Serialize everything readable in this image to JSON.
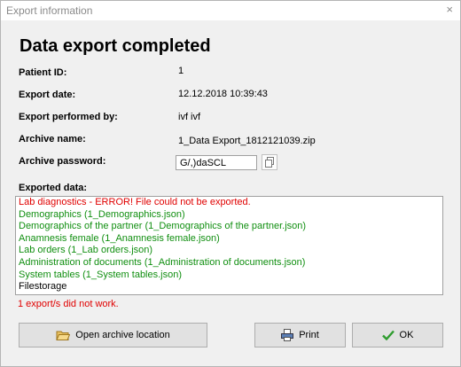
{
  "window": {
    "title": "Export information",
    "close_glyph": "×"
  },
  "heading": "Data export completed",
  "fields": {
    "patient_id_label": "Patient ID:",
    "patient_id_value": "1",
    "export_date_label": "Export date:",
    "export_date_value": "12.12.2018 10:39:43",
    "performed_by_label": "Export performed by:",
    "performed_by_value": "ivf ivf",
    "archive_name_label": "Archive name:",
    "archive_name_value": "1_Data Export_1812121039.zip",
    "archive_password_label": "Archive password:",
    "archive_password_value": "G/,)daSCL"
  },
  "exported": {
    "label": "Exported data:",
    "lines": [
      {
        "text": "Lab diagnostics - ERROR! File could not be exported.",
        "status": "error"
      },
      {
        "text": "Demographics (1_Demographics.json)",
        "status": "ok"
      },
      {
        "text": "Demographics of the partner (1_Demographics of the partner.json)",
        "status": "ok"
      },
      {
        "text": "Anamnesis female (1_Anamnesis female.json)",
        "status": "ok"
      },
      {
        "text": "Lab orders (1_Lab orders.json)",
        "status": "ok"
      },
      {
        "text": "Administration of documents (1_Administration of documents.json)",
        "status": "ok"
      },
      {
        "text": "System tables (1_System tables.json)",
        "status": "ok"
      },
      {
        "text": "Filestorage",
        "status": "plain"
      }
    ],
    "status_text": "1 export/s did not work."
  },
  "buttons": {
    "open_location": "Open archive location",
    "print": "Print",
    "ok": "OK"
  },
  "colors": {
    "error": "#e00000",
    "ok": "#118f11"
  }
}
